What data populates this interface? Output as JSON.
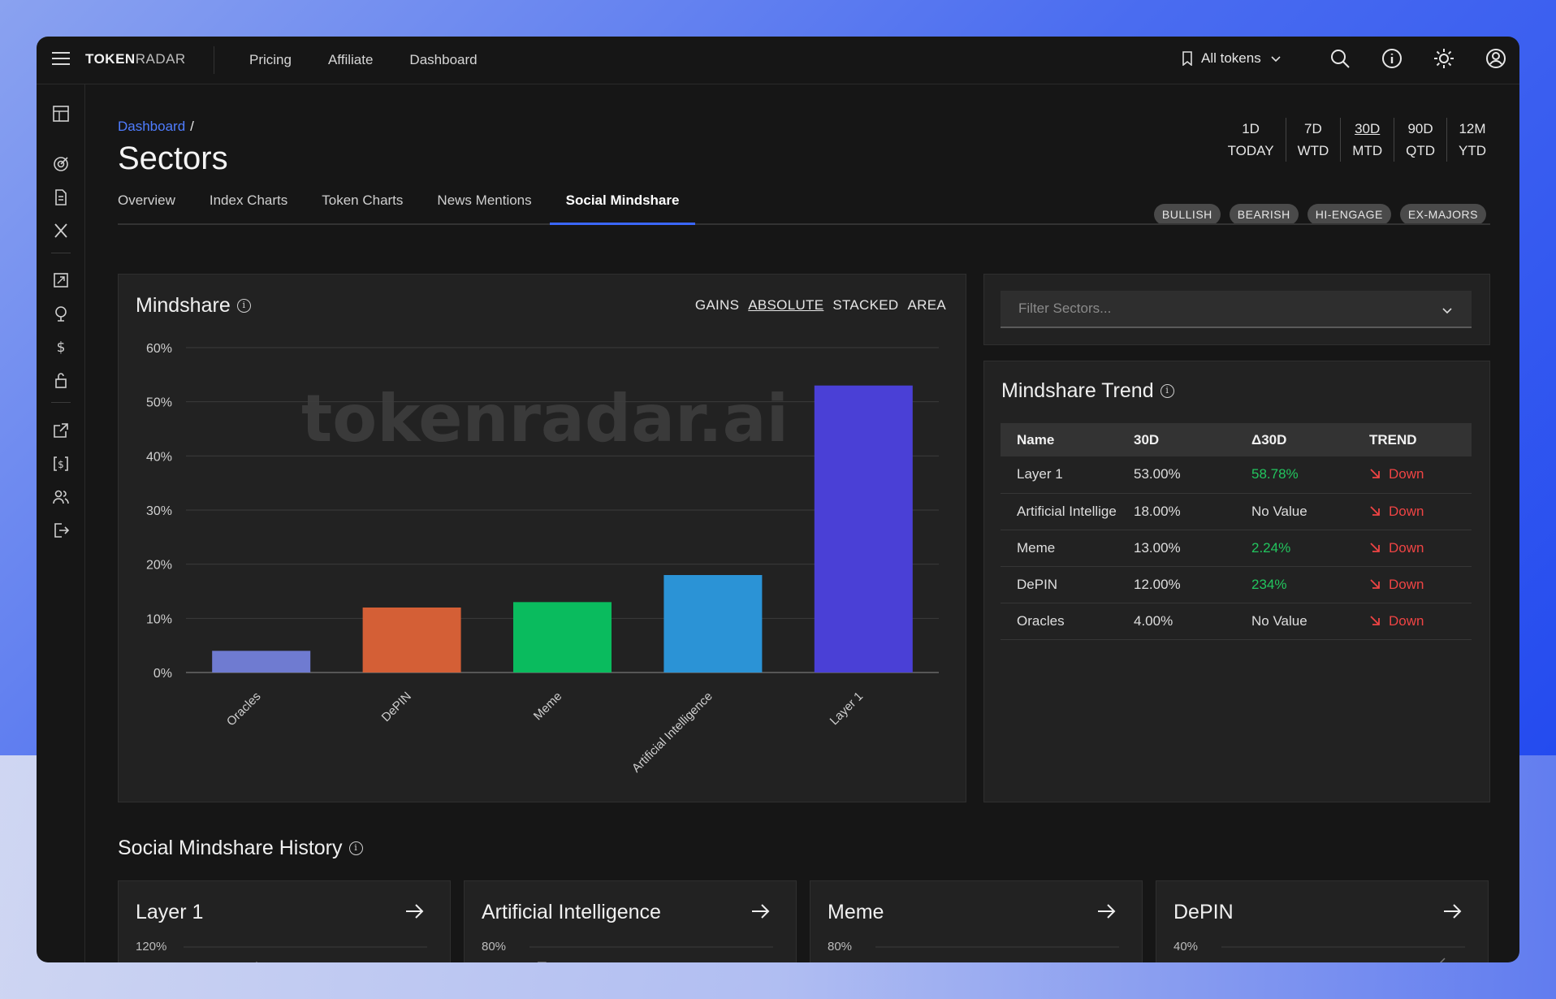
{
  "header": {
    "logo_bold": "TOKEN",
    "logo_light": "RADAR",
    "nav": [
      "Pricing",
      "Affiliate",
      "Dashboard"
    ],
    "token_select": "All tokens"
  },
  "breadcrumb": {
    "root": "Dashboard",
    "separator": "/"
  },
  "page_title": "Sectors",
  "tabs": [
    "Overview",
    "Index Charts",
    "Token Charts",
    "News Mentions",
    "Social Mindshare"
  ],
  "active_tab": "Social Mindshare",
  "periods": [
    {
      "top": "1D",
      "bottom": "TODAY"
    },
    {
      "top": "7D",
      "bottom": "WTD"
    },
    {
      "top": "30D",
      "bottom": "MTD"
    },
    {
      "top": "90D",
      "bottom": "QTD"
    },
    {
      "top": "12M",
      "bottom": "YTD"
    }
  ],
  "selected_period": "30D",
  "filters": [
    "BULLISH",
    "BEARISH",
    "HI-ENGAGE",
    "EX-MAJORS"
  ],
  "mindshare": {
    "title": "Mindshare",
    "modes": [
      "GAINS",
      "ABSOLUTE",
      "STACKED",
      "AREA"
    ],
    "selected_mode": "ABSOLUTE",
    "watermark": "tokenradar.ai"
  },
  "chart_data": {
    "type": "bar",
    "categories": [
      "Oracles",
      "DePIN",
      "Meme",
      "Artificial Intelligence",
      "Layer 1"
    ],
    "values": [
      4,
      12,
      13,
      18,
      53
    ],
    "colors": [
      "#6f7bd1",
      "#d45f36",
      "#0abb5e",
      "#2b93d6",
      "#4a40d6"
    ],
    "ylim": [
      0,
      60
    ],
    "yticks": [
      "0%",
      "10%",
      "20%",
      "30%",
      "40%",
      "50%",
      "60%"
    ],
    "grid": true
  },
  "filter_sectors": {
    "placeholder": "Filter Sectors..."
  },
  "trend": {
    "title": "Mindshare Trend",
    "columns": [
      "Name",
      "30D",
      "Δ30D",
      "TREND"
    ],
    "rows": [
      {
        "name": "Layer 1",
        "v30": "53.00%",
        "delta": "58.78%",
        "delta_positive": true,
        "trend": "Down"
      },
      {
        "name": "Artificial Intelligence",
        "v30": "18.00%",
        "delta": "No Value",
        "delta_positive": false,
        "trend": "Down"
      },
      {
        "name": "Meme",
        "v30": "13.00%",
        "delta": "2.24%",
        "delta_positive": true,
        "trend": "Down"
      },
      {
        "name": "DePIN",
        "v30": "12.00%",
        "delta": "234%",
        "delta_positive": true,
        "trend": "Down"
      },
      {
        "name": "Oracles",
        "v30": "4.00%",
        "delta": "No Value",
        "delta_positive": false,
        "trend": "Down"
      }
    ]
  },
  "history": {
    "title": "Social Mindshare History",
    "cards": [
      {
        "title": "Layer 1",
        "y_top": "120%"
      },
      {
        "title": "Artificial Intelligence",
        "y_top": "80%"
      },
      {
        "title": "Meme",
        "y_top": "80%"
      },
      {
        "title": "DePIN",
        "y_top": "40%"
      }
    ]
  }
}
